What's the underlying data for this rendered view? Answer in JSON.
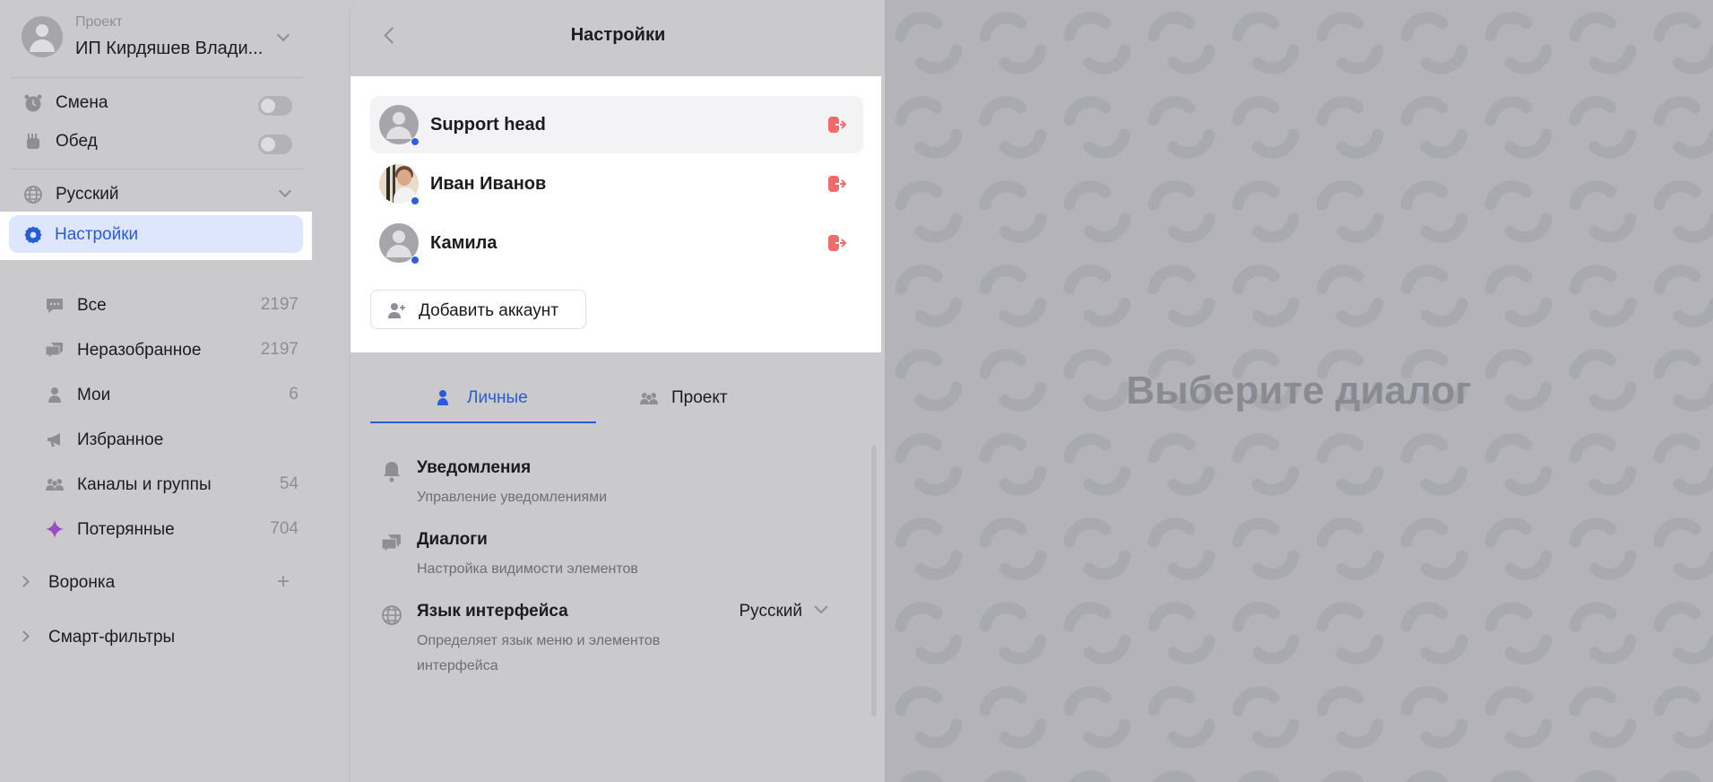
{
  "project": {
    "caption": "Проект",
    "name": "ИП Кирдяшев Влади..."
  },
  "status": [
    {
      "label": "Смена",
      "icon": "alarm-clock-icon",
      "on": false
    },
    {
      "label": "Обед",
      "icon": "lunch-icon",
      "on": false
    }
  ],
  "language": {
    "label": "Русский",
    "icon": "globe-icon"
  },
  "settings_item": {
    "label": "Настройки",
    "icon": "gear-icon"
  },
  "nav": [
    {
      "label": "Все",
      "count": "2197",
      "icon": "chat-bubble-icon"
    },
    {
      "label": "Неразобранное",
      "count": "2197",
      "icon": "chat-bubbles-icon"
    },
    {
      "label": "Мои",
      "count": "6",
      "icon": "person-icon"
    },
    {
      "label": "Избранное",
      "count": "",
      "icon": "megaphone-icon"
    },
    {
      "label": "Каналы и группы",
      "count": "54",
      "icon": "group-icon"
    },
    {
      "label": "Потерянные",
      "count": "704",
      "icon": "diamond-icon"
    }
  ],
  "sections": [
    {
      "label": "Воронка",
      "has_add": true
    },
    {
      "label": "Смарт-фильтры",
      "has_add": false
    }
  ],
  "panel": {
    "title": "Настройки",
    "accounts": [
      {
        "name": "Support head",
        "avatar": "placeholder",
        "online": true,
        "selected": true
      },
      {
        "name": "Иван Иванов",
        "avatar": "photo",
        "online": true,
        "selected": false
      },
      {
        "name": "Камила",
        "avatar": "placeholder",
        "online": true,
        "selected": false
      }
    ],
    "add_account": "Добавить аккаунт",
    "tabs": [
      {
        "label": "Личные",
        "icon": "person-icon",
        "active": true
      },
      {
        "label": "Проект",
        "icon": "group-icon",
        "active": false
      }
    ],
    "settings": [
      {
        "title": "Уведомления",
        "desc": "Управление уведомлениями",
        "icon": "bell-icon"
      },
      {
        "title": "Диалоги",
        "desc": "Настройка видимости элементов",
        "icon": "chat-bubbles-icon"
      },
      {
        "title": "Язык интерфейса",
        "desc": "Определяет язык меню и элементов интерфейса",
        "icon": "globe-icon",
        "value": "Русский"
      }
    ]
  },
  "empty_state": "Выберите диалог",
  "colors": {
    "accent": "#2a5bd7",
    "logout": "#f26b6b",
    "online_dot": "#2d5fe0",
    "highlight": "#dde6fc"
  }
}
